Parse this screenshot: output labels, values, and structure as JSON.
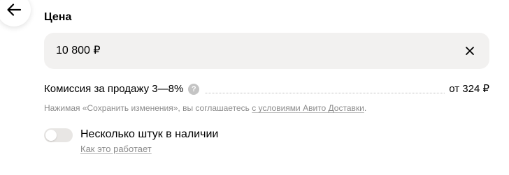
{
  "navigation": {
    "back_icon": "arrow-left-icon"
  },
  "price_section": {
    "title": "Цена",
    "value": "10 800 ₽",
    "clear_icon": "close-icon"
  },
  "commission": {
    "label": "Комиссия за продажу 3—8%",
    "help_icon_glyph": "?",
    "amount": "от 324 ₽"
  },
  "disclaimer": {
    "prefix": "Нажимая «Сохранить изменения», вы соглашаетесь ",
    "link": "с условиями Авито Доставки",
    "suffix": "."
  },
  "multiple_items": {
    "toggle_state": "off",
    "label": "Несколько штук в наличии",
    "link": "Как это работает"
  },
  "colors": {
    "field_background": "#f2f1f0",
    "muted_text": "#8c8c8c",
    "toggle_off": "#e8e6e4",
    "help_icon": "#c4c4c4"
  }
}
